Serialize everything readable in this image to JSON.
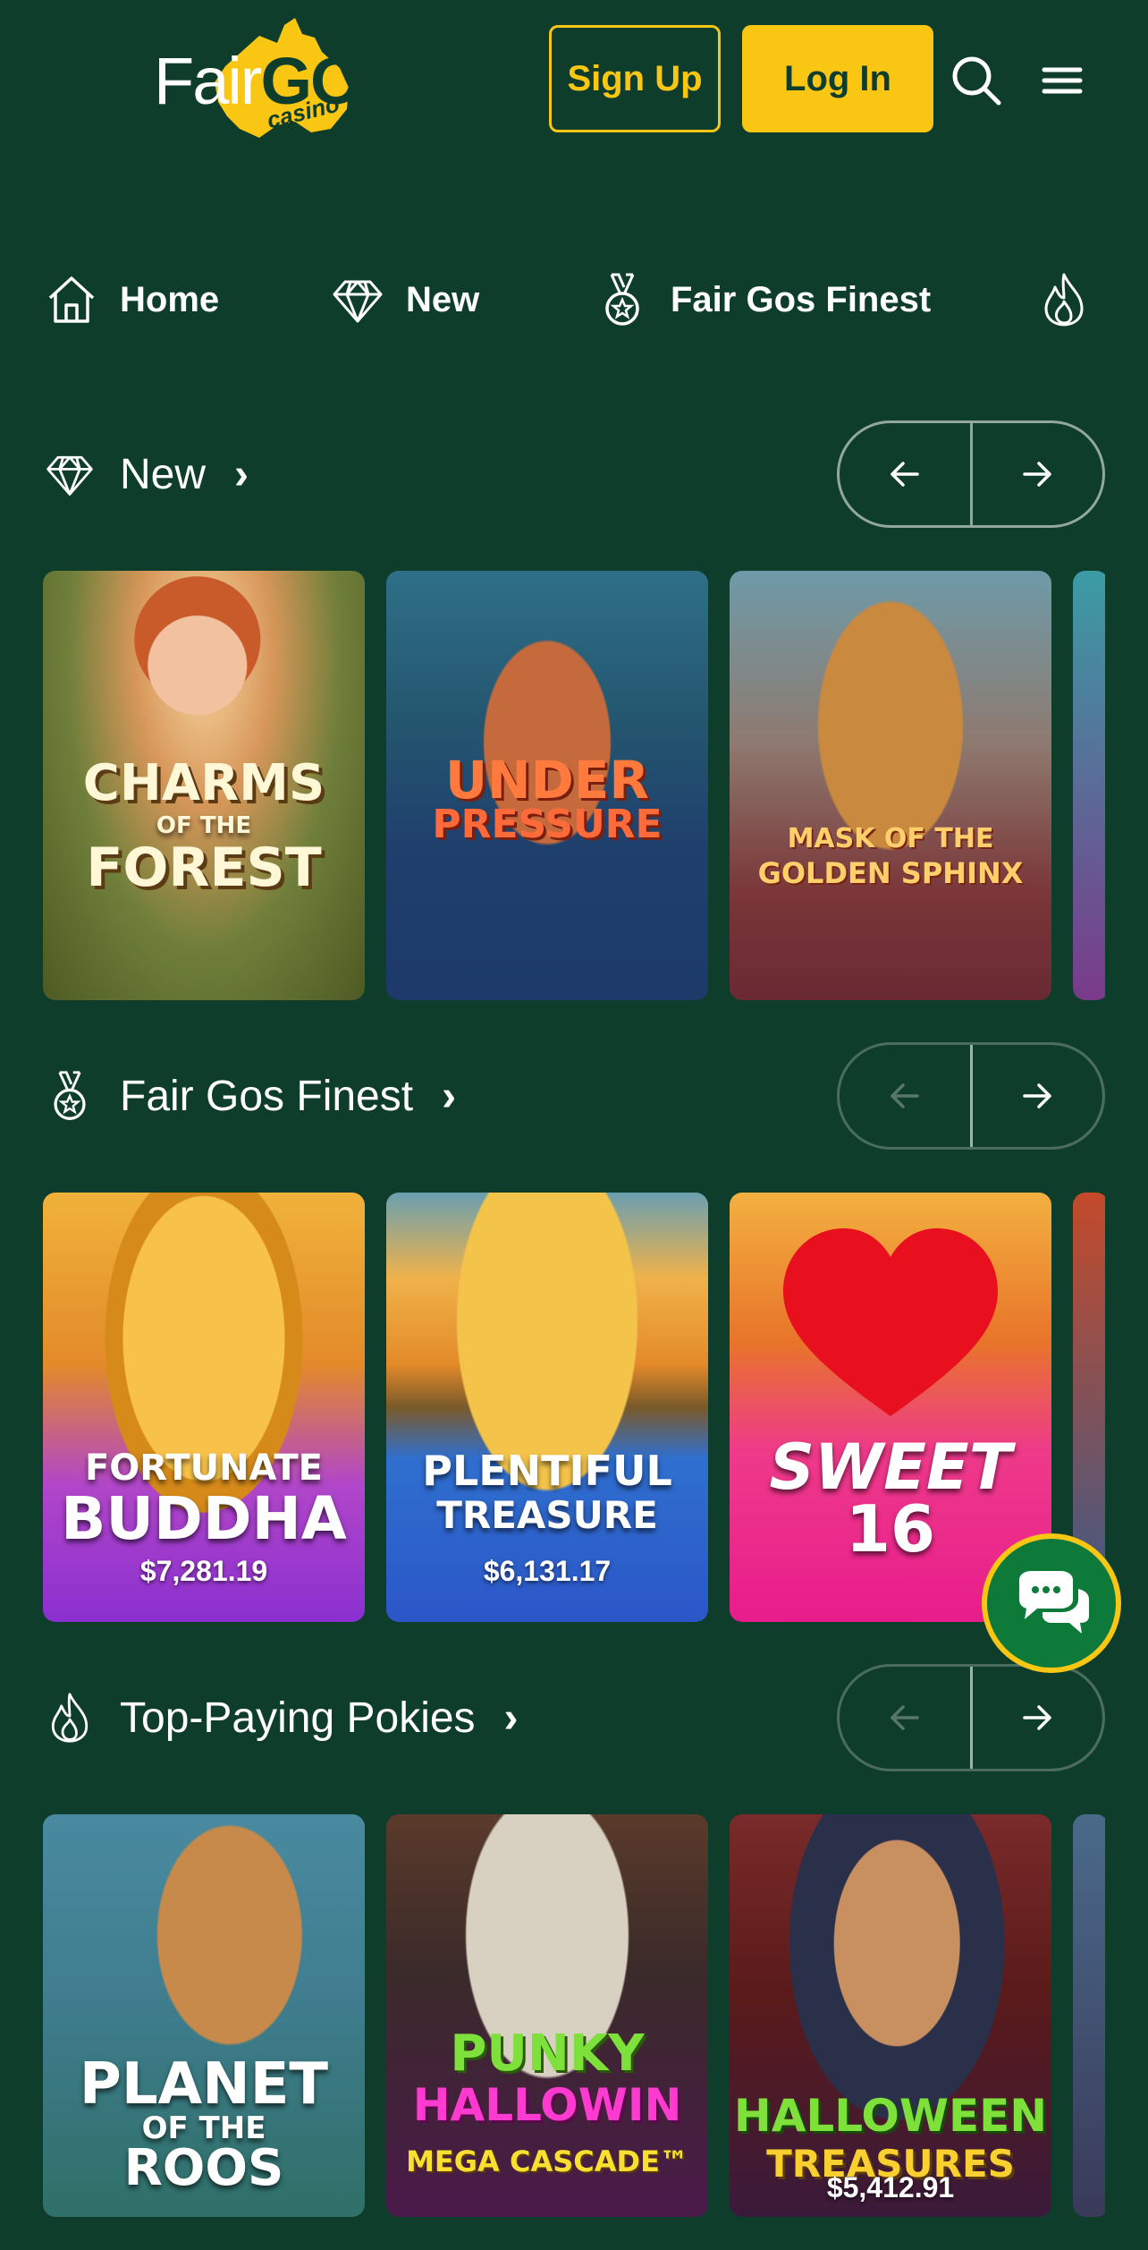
{
  "header": {
    "logo_fair": "Fair",
    "logo_go": "GO",
    "logo_casino": "casino",
    "signup_label": "Sign Up",
    "login_label": "Log In"
  },
  "nav": [
    {
      "label": "Home",
      "icon": "home-icon"
    },
    {
      "label": "New",
      "icon": "diamond-icon"
    },
    {
      "label": "Fair Gos Finest",
      "icon": "medal-icon"
    },
    {
      "label": "",
      "icon": "flame-icon"
    }
  ],
  "sections": [
    {
      "title": "New",
      "icon": "diamond-icon",
      "games": [
        {
          "name": "Charms of the Forest",
          "line1": "CHARMS",
          "line2": "OF THE",
          "line3": "FOREST",
          "jackpot": ""
        },
        {
          "name": "Under Pressure",
          "line1": "UNDER",
          "line2": "PRESSURE",
          "line3": "",
          "jackpot": ""
        },
        {
          "name": "Mask of the Golden Sphinx",
          "line1": "MASK OF THE",
          "line2": "GOLDEN SPHINX",
          "line3": "",
          "jackpot": ""
        }
      ]
    },
    {
      "title": "Fair Gos Finest",
      "icon": "medal-icon",
      "games": [
        {
          "name": "Fortunate Buddha",
          "line1": "FORTUNATE",
          "line2": "BUDDHA",
          "line3": "",
          "jackpot": "$7,281.19"
        },
        {
          "name": "Plentiful Treasure",
          "line1": "PLENTIFUL",
          "line2": "TREASURE",
          "line3": "",
          "jackpot": "$6,131.17"
        },
        {
          "name": "Sweet 16",
          "line1": "SWEET",
          "line2": "16",
          "line3": "",
          "jackpot": ""
        }
      ]
    },
    {
      "title": "Top-Paying Pokies",
      "icon": "flame-icon",
      "games": [
        {
          "name": "Planet of the Roos",
          "line1": "PLANET",
          "line2": "OF THE",
          "line3": "ROOS",
          "jackpot": ""
        },
        {
          "name": "Punky HalloWin Mega Cascade",
          "line1": "PUNKY",
          "line2": "HALLOWIN",
          "line3": "MEGA CASCADE™",
          "jackpot": ""
        },
        {
          "name": "Halloween Treasures",
          "line1": "HALLOWEEN",
          "line2": "TREASURES",
          "line3": "",
          "jackpot": "$5,412.91"
        }
      ]
    }
  ],
  "colors": {
    "background": "#0f3d2c",
    "accent": "#f9c613",
    "chat": "#0e7a3a"
  }
}
